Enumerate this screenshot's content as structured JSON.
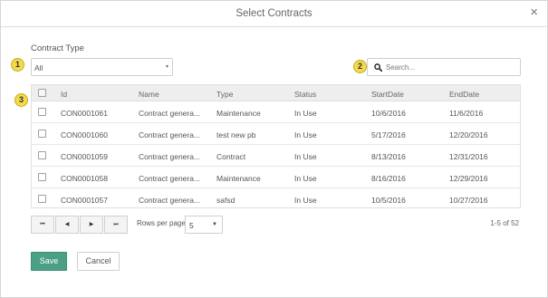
{
  "dialog": {
    "title": "Select Contracts",
    "close_glyph": "×"
  },
  "filter": {
    "label": "Contract Type",
    "selected": "All",
    "caret": "▾"
  },
  "search": {
    "placeholder": "Search..."
  },
  "callouts": [
    "1",
    "2",
    "3"
  ],
  "table": {
    "columns": [
      "Id",
      "Name",
      "Type",
      "Status",
      "StartDate",
      "EndDate"
    ],
    "rows": [
      [
        "CON0001061",
        "Contract genera...",
        "Maintenance",
        "In Use",
        "10/6/2016",
        "11/6/2016"
      ],
      [
        "CON0001060",
        "Contract genera...",
        "test new pb",
        "In Use",
        "5/17/2016",
        "12/20/2016"
      ],
      [
        "CON0001059",
        "Contract genera...",
        "Contract",
        "In Use",
        "8/13/2016",
        "12/31/2016"
      ],
      [
        "CON0001058",
        "Contract genera...",
        "Maintenance",
        "In Use",
        "8/16/2016",
        "12/29/2016"
      ],
      [
        "CON0001057",
        "Contract genera...",
        "safsd",
        "In Use",
        "10/5/2016",
        "10/27/2016"
      ]
    ]
  },
  "pager": {
    "first": "⏮",
    "prev": "◀",
    "next": "▶",
    "last": "⏭",
    "rows_per_page_label": "Rows per page:",
    "rows_per_page": "5",
    "caret": "▼",
    "info": "1-5 of 52"
  },
  "actions": {
    "save": "Save",
    "cancel": "Cancel"
  },
  "colors": {
    "accent": "#4a9f86",
    "callout": "#f2d94e"
  }
}
